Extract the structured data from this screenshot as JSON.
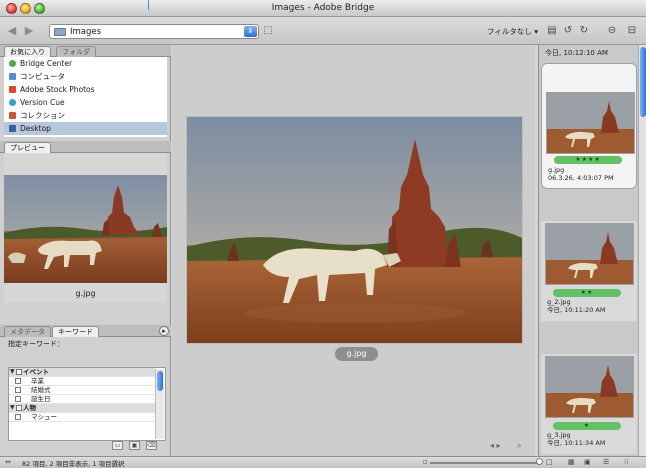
{
  "window": {
    "title": "Images - Adobe Bridge"
  },
  "toolbar": {
    "path_label": "Images",
    "filter_label": "フィルタなし ▾"
  },
  "left": {
    "fav_tabs": [
      "お気に入り",
      "フォルダ"
    ],
    "favorites": [
      {
        "label": "Bridge Center",
        "icon": "bridge-center-icon",
        "color": "#4fa84a"
      },
      {
        "label": "コンピュータ",
        "icon": "computer-icon",
        "color": "#5a8ad0"
      },
      {
        "label": "Adobe Stock Photos",
        "icon": "stock-photos-icon",
        "color": "#d84a2a"
      },
      {
        "label": "Version Cue",
        "icon": "version-cue-icon",
        "color": "#3aa0c8"
      },
      {
        "label": "コレクション",
        "icon": "collection-icon",
        "color": "#c85a3a"
      },
      {
        "label": "Desktop",
        "icon": "desktop-icon",
        "color": "#3a5f9a"
      }
    ],
    "preview_tab": "プレビュー",
    "preview_filename": "g.jpg",
    "meta_tabs": [
      "メタデータ",
      "キーワード"
    ],
    "assigned_keywords_label": "指定キーワード：",
    "keywords": [
      {
        "label": "イベント",
        "category": true
      },
      {
        "label": "卒業",
        "category": false
      },
      {
        "label": "結婚式",
        "category": false
      },
      {
        "label": "誕生日",
        "category": false
      },
      {
        "label": "人物",
        "category": true
      },
      {
        "label": "マシュー",
        "category": false
      }
    ]
  },
  "center": {
    "filename": "g.jpg"
  },
  "right": {
    "top_text": "今日, 10:12:10 AM",
    "cards": [
      {
        "rating": "★★★★",
        "name": "g.jpg",
        "date": "06.3.26, 4:03:07 PM",
        "selected": true
      },
      {
        "rating": "★★",
        "name": "g_2.jpg",
        "date": "今日, 10:11:20 AM",
        "selected": false
      },
      {
        "rating": "★",
        "name": "g_3.jpg",
        "date": "今日, 10:11:34 AM",
        "selected": false
      }
    ]
  },
  "status": {
    "text": "82 項目, 2 項目非表示, 1 項目選択"
  }
}
